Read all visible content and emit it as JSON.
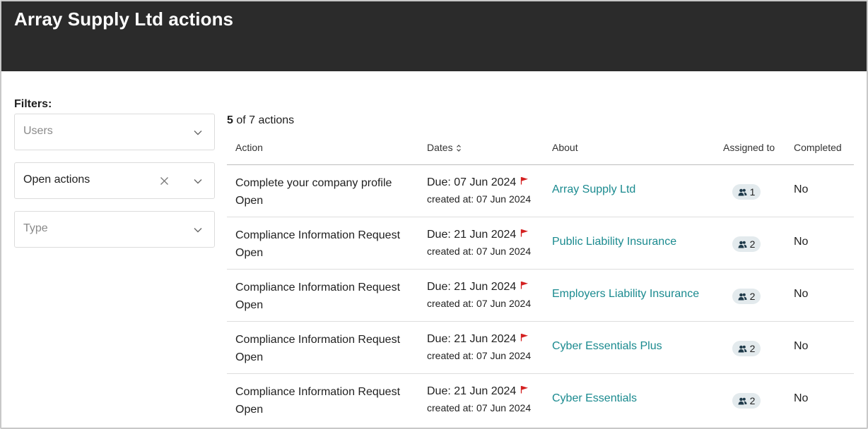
{
  "header": {
    "title": "Array Supply Ltd actions"
  },
  "filters": {
    "label": "Filters:",
    "users": {
      "placeholder": "Users"
    },
    "status": {
      "value": "Open actions"
    },
    "type": {
      "placeholder": "Type"
    }
  },
  "summary": {
    "shown": "5",
    "rest": " of 7 actions"
  },
  "columns": {
    "action": "Action",
    "dates": "Dates",
    "about": "About",
    "assigned": "Assigned to",
    "completed": "Completed"
  },
  "rows": [
    {
      "action": "Complete your company profile",
      "status": "Open",
      "due": "Due: 07 Jun 2024",
      "created": "created at: 07 Jun 2024",
      "about": "Array Supply Ltd",
      "assigned": "1",
      "completed": "No"
    },
    {
      "action": "Compliance Information Request",
      "status": "Open",
      "due": "Due: 21 Jun 2024",
      "created": "created at: 07 Jun 2024",
      "about": "Public Liability Insurance",
      "assigned": "2",
      "completed": "No"
    },
    {
      "action": "Compliance Information Request",
      "status": "Open",
      "due": "Due: 21 Jun 2024",
      "created": "created at: 07 Jun 2024",
      "about": "Employers Liability Insurance",
      "assigned": "2",
      "completed": "No"
    },
    {
      "action": "Compliance Information Request",
      "status": "Open",
      "due": "Due: 21 Jun 2024",
      "created": "created at: 07 Jun 2024",
      "about": "Cyber Essentials Plus",
      "assigned": "2",
      "completed": "No"
    },
    {
      "action": "Compliance Information Request",
      "status": "Open",
      "due": "Due: 21 Jun 2024",
      "created": "created at: 07 Jun 2024",
      "about": "Cyber Essentials",
      "assigned": "2",
      "completed": "No"
    }
  ],
  "icons": {
    "flag": "flag-icon",
    "users": "users-icon",
    "sort": "sort-icon",
    "chevron": "chevron-down-icon",
    "clear": "close-icon"
  },
  "colors": {
    "header_bg": "#2b2b2b",
    "link": "#1a8a8f",
    "flag": "#d42020",
    "pill_bg": "#e3eaed"
  }
}
